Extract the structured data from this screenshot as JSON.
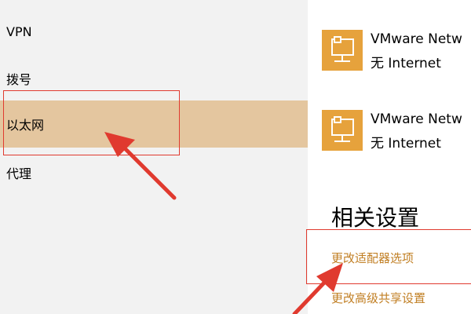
{
  "sidebar": {
    "items": [
      {
        "label": "VPN"
      },
      {
        "label": "拨号"
      },
      {
        "label": "以太网"
      },
      {
        "label": "代理"
      }
    ],
    "selected": "以太网",
    "selected_color": "#e4c69f"
  },
  "main": {
    "adapters": [
      {
        "name": "VMware Netw",
        "status": "无 Internet",
        "icon": "network-adapter-icon"
      },
      {
        "name": "VMware Netw",
        "status": "无 Internet",
        "icon": "network-adapter-icon"
      }
    ],
    "related_heading": "相关设置",
    "links": [
      {
        "label": "更改适配器选项"
      },
      {
        "label": "更改高级共享设置"
      }
    ],
    "link_color": "#c17f24",
    "accent_icon_color": "#e6a23c"
  },
  "annotations": {
    "highlight_color": "#e03a2f"
  }
}
